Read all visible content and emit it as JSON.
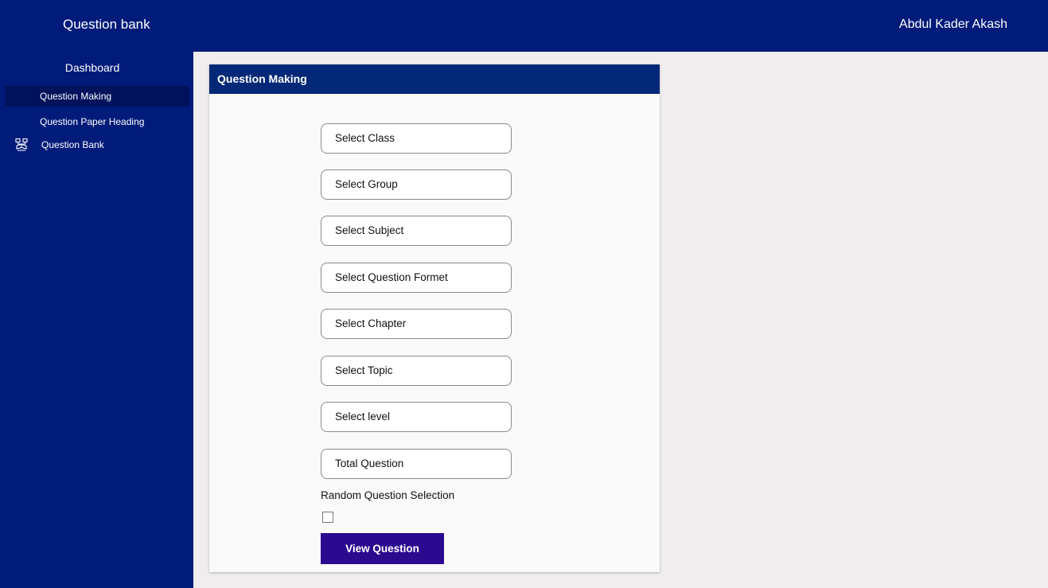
{
  "header": {
    "app_title": "Question bank",
    "user_name": "Abdul Kader Akash"
  },
  "sidebar": {
    "dashboard_label": "Dashboard",
    "items": [
      {
        "label": "Question Making",
        "active": true
      },
      {
        "label": "Question Paper Heading",
        "active": false
      },
      {
        "label": "Question Bank",
        "active": false,
        "icon": "question-bank-icon"
      }
    ]
  },
  "form": {
    "title": "Question Making",
    "fields": [
      {
        "label": "Select Class"
      },
      {
        "label": "Select Group"
      },
      {
        "label": "Select Subject"
      },
      {
        "label": "Select Question Formet"
      },
      {
        "label": "Select Chapter"
      },
      {
        "label": "Select Topic"
      },
      {
        "label": "Select level"
      },
      {
        "label": "Total Question"
      }
    ],
    "random_selection_label": "Random Question Selection",
    "random_selection_checked": false,
    "submit_label": "View Question"
  },
  "colors": {
    "nav_bg": "#001b7a",
    "nav_active_bg": "#00125c",
    "card_header_bg": "#042878",
    "button_bg": "#2b0a8f",
    "page_bg": "#efedee"
  }
}
